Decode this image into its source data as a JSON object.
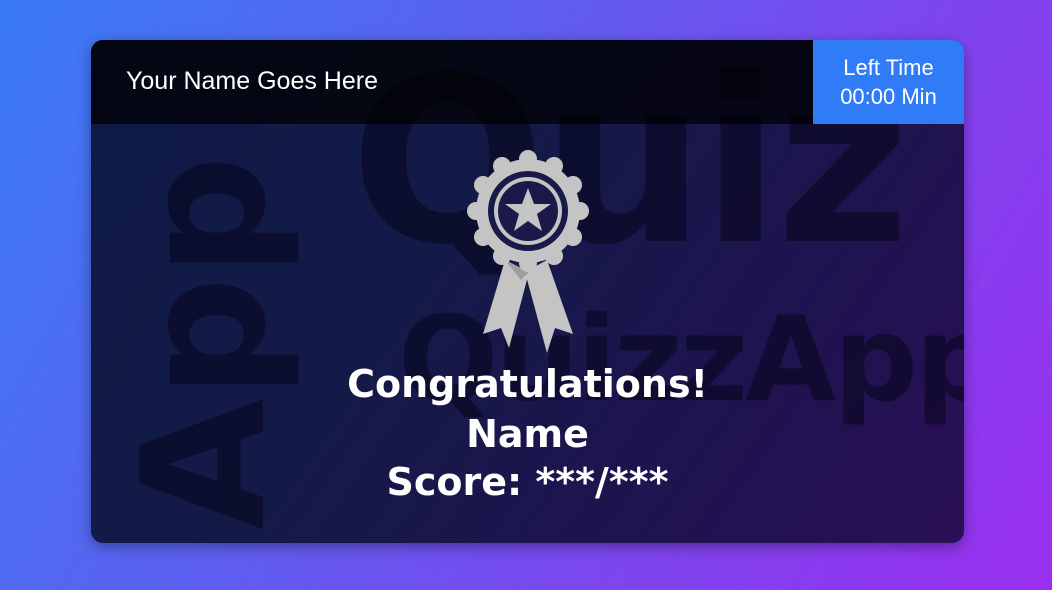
{
  "watermarks": {
    "quiz": "Quiz",
    "quizzapp": "QuizzApp",
    "app": "App"
  },
  "header": {
    "user_name": "Your Name Goes Here"
  },
  "timer": {
    "label": "Left Time",
    "value": "00:00 Min"
  },
  "result": {
    "title": "Congratulations!",
    "name": "Name",
    "score": "Score: ***/***"
  },
  "colors": {
    "timer_bg": "#2f7cf6",
    "badge": "#c4c4c4"
  },
  "icons": {
    "badge": "award-ribbon-icon"
  }
}
